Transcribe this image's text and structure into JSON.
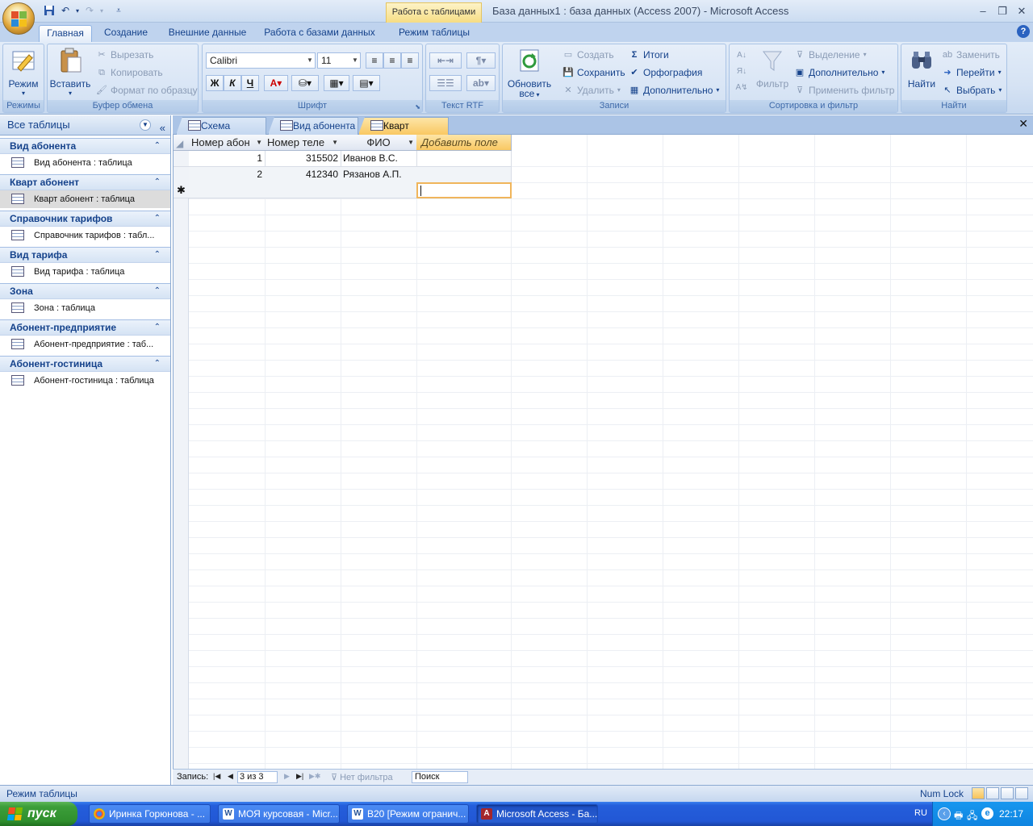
{
  "titlebar": {
    "context_tab": "Работа с таблицами",
    "title": "База данных1 : база данных (Access 2007)  -  Microsoft Access",
    "minimize": "–",
    "maximize": "❐",
    "close": "✕"
  },
  "ribbon_tabs": [
    "Главная",
    "Создание",
    "Внешние данные",
    "Работа с базами данных",
    "Режим таблицы"
  ],
  "ribbon": {
    "groups": {
      "views": "Режимы",
      "clipboard": "Буфер обмена",
      "font": "Шрифт",
      "rtf": "Текст RTF",
      "records": "Записи",
      "sort_filter": "Сортировка и фильтр",
      "find": "Найти"
    },
    "view_btn": "Режим",
    "paste_btn": "Вставить",
    "cut": "Вырезать",
    "copy": "Копировать",
    "format_painter": "Формат по образцу",
    "font_name": "Calibri",
    "font_size": "11",
    "bold": "Ж",
    "italic": "К",
    "underline": "Ч",
    "refresh_btn_1": "Обновить",
    "refresh_btn_2": "все",
    "new": "Создать",
    "save": "Сохранить",
    "delete": "Удалить",
    "totals": "Итоги",
    "spelling": "Орфография",
    "more": "Дополнительно",
    "filter_btn": "Фильтр",
    "selection": "Выделение",
    "advanced": "Дополнительно",
    "apply_filter": "Применить фильтр",
    "find_btn": "Найти",
    "replace": "Заменить",
    "goto": "Перейти",
    "select": "Выбрать"
  },
  "nav": {
    "header": "Все таблицы",
    "groups": [
      {
        "title": "Вид абонента",
        "item": "Вид абонента : таблица"
      },
      {
        "title": "Кварт абонент",
        "item": "Кварт абонент : таблица"
      },
      {
        "title": "Справочник тарифов",
        "item": "Справочник тарифов : табл..."
      },
      {
        "title": "Вид тарифа",
        "item": "Вид тарифа : таблица"
      },
      {
        "title": "Зона",
        "item": "Зона : таблица"
      },
      {
        "title": "Абонент-предприятие",
        "item": "Абонент-предприятие : таб..."
      },
      {
        "title": "Абонент-гостиница",
        "item": "Абонент-гостиница : таблица"
      }
    ]
  },
  "doc_tabs": [
    "Схема данных",
    "Вид абонента",
    "Кварт абонент"
  ],
  "sheet": {
    "columns": [
      "Номер абон",
      "Номер теле",
      "ФИО",
      "Добавить поле"
    ],
    "rows": [
      [
        "1",
        "315502",
        "Иванов В.С."
      ],
      [
        "2",
        "412340",
        "Рязанов А.П."
      ]
    ],
    "new_row_marker": "✱"
  },
  "record_nav": {
    "label": "Запись:",
    "position": "3 из 3",
    "no_filter": "Нет фильтра",
    "search": "Поиск"
  },
  "status": {
    "mode": "Режим таблицы",
    "numlock": "Num Lock"
  },
  "taskbar": {
    "start": "пуск",
    "tasks": [
      "Иринка Горюнова - ...",
      "МОЯ курсовая - Micr...",
      "В20 [Режим огранич...",
      "Microsoft Access - Ба..."
    ],
    "lang": "RU",
    "clock": "22:17"
  }
}
